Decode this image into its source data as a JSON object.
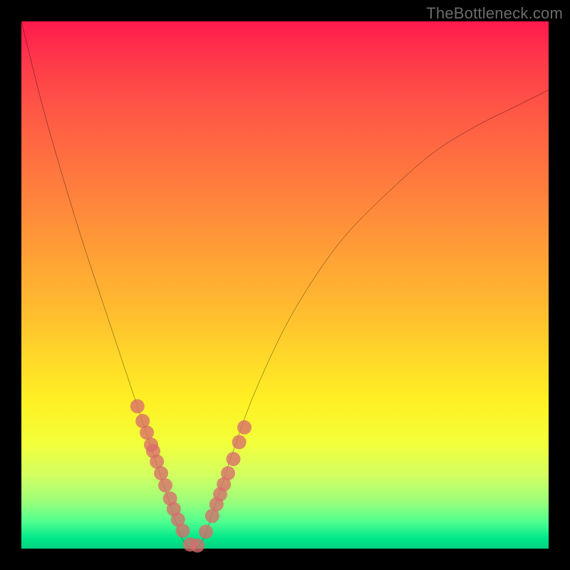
{
  "attribution": "TheBottleneck.com",
  "chart_data": {
    "type": "line",
    "title": "",
    "xlabel": "",
    "ylabel": "",
    "xlim": [
      0,
      100
    ],
    "ylim": [
      0,
      100
    ],
    "grid": false,
    "legend": false,
    "background_gradient": [
      "#ff1a4d",
      "#ff9a37",
      "#fff023",
      "#00d080"
    ],
    "series": [
      {
        "name": "bottleneck-curve",
        "type": "line",
        "stroke": "#000000",
        "x": [
          0,
          4,
          8,
          12,
          16,
          20,
          22,
          24,
          26,
          27,
          28,
          29,
          30,
          31,
          32,
          33,
          34,
          35,
          36,
          38,
          40,
          44,
          50,
          56,
          62,
          70,
          78,
          86,
          94,
          100
        ],
        "y": [
          100,
          84,
          70,
          57,
          45,
          33,
          27,
          21,
          15,
          12,
          9,
          6,
          3,
          1,
          0,
          0,
          1,
          3,
          6,
          12,
          18,
          29,
          42,
          52,
          60,
          68,
          75,
          80,
          84,
          87
        ]
      },
      {
        "name": "measured-points",
        "type": "scatter",
        "marker_color": "#d96b6b",
        "marker_radius_pct": 1.35,
        "x": [
          22.0,
          23.0,
          23.8,
          24.6,
          25.0,
          25.7,
          26.5,
          27.3,
          28.2,
          28.9,
          29.7,
          30.6,
          32.0,
          33.4,
          35.0,
          36.2,
          37.0,
          37.7,
          38.4,
          39.2,
          40.2,
          41.3,
          42.3
        ],
        "y": [
          27.0,
          24.2,
          22.0,
          19.7,
          18.5,
          16.5,
          14.3,
          12.0,
          9.5,
          7.5,
          5.5,
          3.4,
          0.8,
          0.6,
          3.2,
          6.2,
          8.4,
          10.3,
          12.2,
          14.3,
          17.0,
          20.2,
          23.0
        ]
      }
    ]
  }
}
